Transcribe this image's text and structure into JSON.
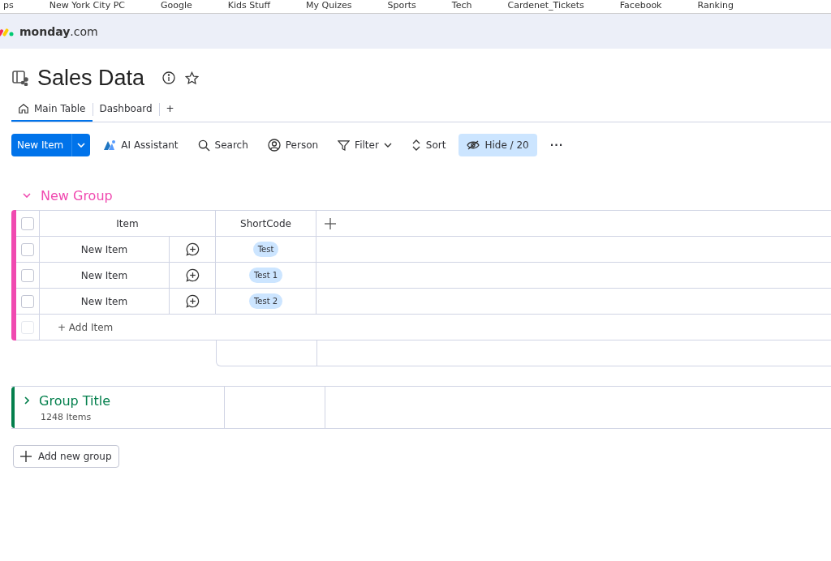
{
  "bookmarks": [
    "ps",
    "New York City PC",
    "Google",
    "Kids Stuff",
    "My Quizes",
    "Sports",
    "Tech",
    "Cardenet_Tickets",
    "Facebook",
    "Ranking"
  ],
  "brand": {
    "name": "monday",
    "suffix": ".com"
  },
  "board": {
    "title": "Sales Data"
  },
  "tabs": [
    {
      "label": "Main Table",
      "selected": true
    },
    {
      "label": "Dashboard",
      "selected": false
    },
    {
      "label": "+",
      "selected": false
    }
  ],
  "toolbar": {
    "primary": "New Item",
    "items": [
      {
        "kind": "ai",
        "label": "AI Assistant"
      },
      {
        "kind": "search",
        "label": "Search"
      },
      {
        "kind": "person",
        "label": "Person"
      },
      {
        "kind": "filter",
        "label": "Filter"
      },
      {
        "kind": "sort",
        "label": "Sort"
      },
      {
        "kind": "hide",
        "label": "Hide / 20"
      },
      {
        "kind": "more",
        "label": "···"
      }
    ]
  },
  "groups": [
    {
      "title": "New Group",
      "color": "#f04ab0",
      "expanded": true,
      "select_all_checked": false,
      "columns": [
        "Item",
        "ShortCode"
      ],
      "rows": [
        {
          "item": "New Item",
          "shortcode": "Test",
          "checked": false
        },
        {
          "item": "New Item",
          "shortcode": "Test 1",
          "checked": false
        },
        {
          "item": "New Item",
          "shortcode": "Test 2",
          "checked": false
        }
      ],
      "add_item": "+ Add Item",
      "add_item_checkbox_disabled": true
    },
    {
      "title": "Group Title",
      "color": "#037f4c",
      "expanded": false,
      "count": "1248 Items"
    }
  ],
  "add_group": "Add new group"
}
